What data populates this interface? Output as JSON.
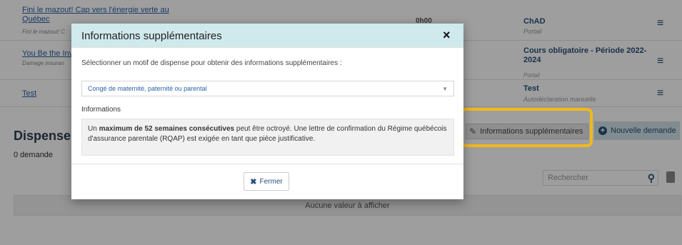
{
  "rows": [
    {
      "title": "Fini le mazout! Cap vers l'énergie verte au Québec",
      "subtitle": "Fini le mazout! C",
      "meta": "0h00",
      "right_title": "ChAD",
      "right_subtitle": "Portail"
    },
    {
      "title": "You Be the Inv",
      "subtitle": "Damage insuran",
      "right_title": "Cours obligatoire - Période 2022-2024",
      "right_subtitle": "Portail"
    },
    {
      "title": "Test",
      "right_title": "Test",
      "right_subtitle": "Autodéclaration manuelle"
    }
  ],
  "section": {
    "title": "Dispenses",
    "count": "0 demande"
  },
  "buttons": {
    "info_label": "Informations supplémentaires",
    "new_label": "Nouvelle demande"
  },
  "search": {
    "placeholder": "Rechercher"
  },
  "empty_text": "Aucune valeur à afficher",
  "modal": {
    "title": "Informations supplémentaires",
    "close_glyph": "×",
    "prompt": "Sélectionner un motif de dispense pour obtenir des informations supplémentaires :",
    "selected_option": "Congé de maternité, paternité ou parental",
    "info_label": "Informations",
    "info_text_pre": "Un ",
    "info_text_bold": "maximum de 52 semaines consécutives",
    "info_text_post": " peut être octroyé. Une lettre de confirmation du Régime québécois d'assurance parentale (RQAP) est exigée en tant que pièce justificative.",
    "close_button_label": "Fermer"
  },
  "colors": {
    "highlight": "#f2b81b",
    "header_bg": "#cfe9ec",
    "link": "#2b5fa5"
  }
}
